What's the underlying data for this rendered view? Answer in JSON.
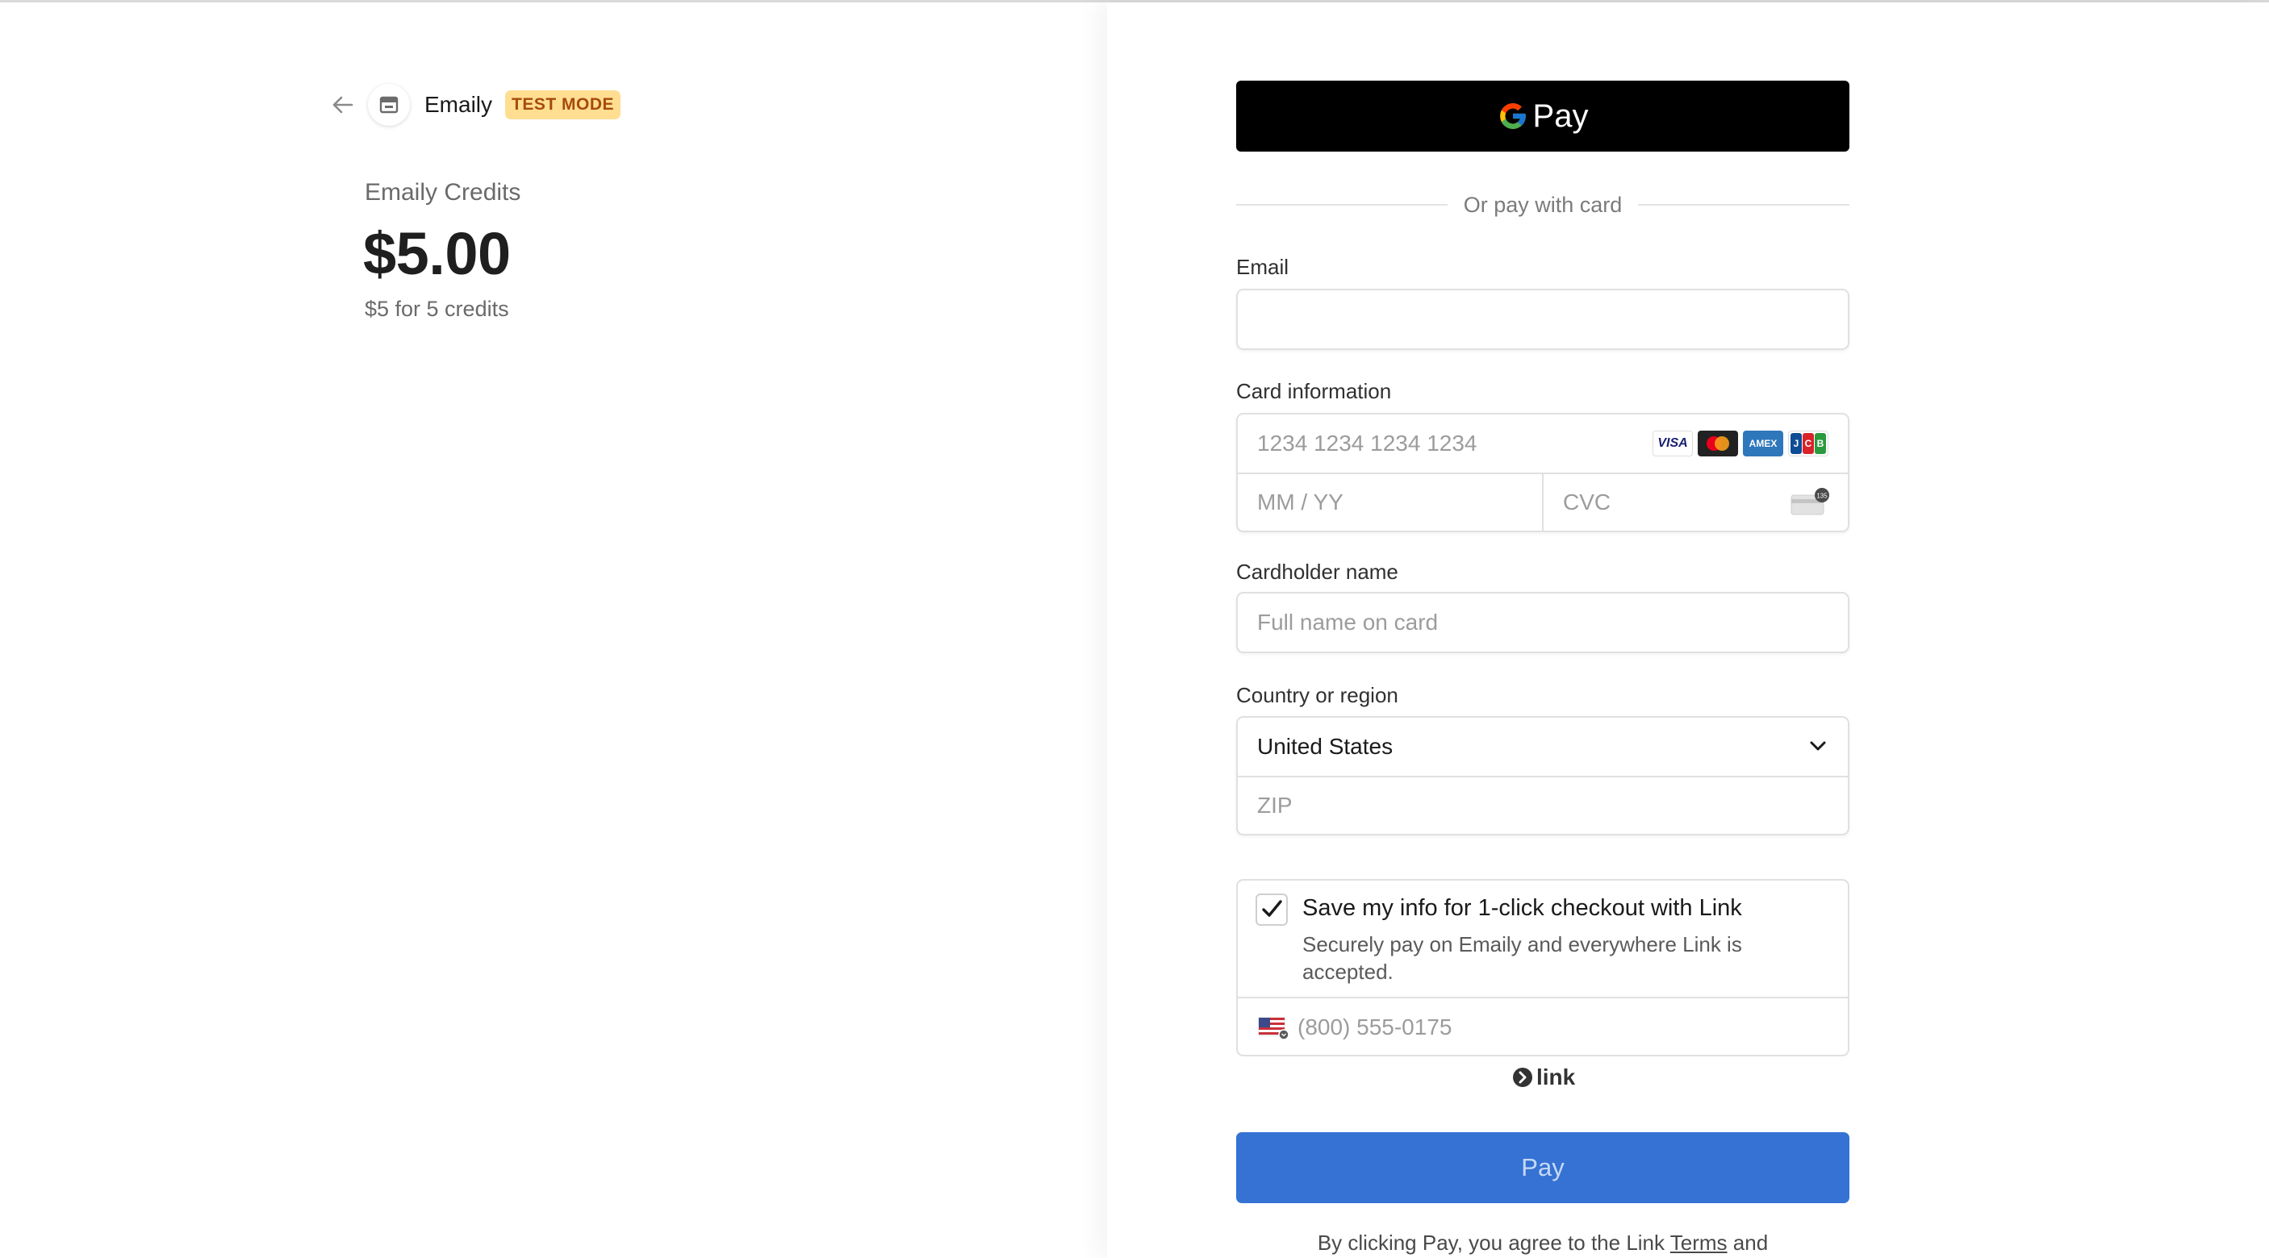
{
  "merchant": {
    "name": "Emaily",
    "badge": "TEST MODE"
  },
  "product": {
    "name": "Emaily Credits",
    "price": "$5.00",
    "description": "$5 for 5 credits"
  },
  "gpay": {
    "label": "Pay"
  },
  "divider": {
    "text": "Or pay with card"
  },
  "email": {
    "label": "Email",
    "value": ""
  },
  "card": {
    "label": "Card information",
    "number_placeholder": "1234 1234 1234 1234",
    "expiry_placeholder": "MM / YY",
    "cvc_placeholder": "CVC",
    "brands": [
      "VISA",
      "mastercard",
      "AMEX",
      "JCB"
    ],
    "cvc_badge": "135"
  },
  "cardholder": {
    "label": "Cardholder name",
    "placeholder": "Full name on card"
  },
  "country": {
    "label": "Country or region",
    "selected": "United States",
    "zip_placeholder": "ZIP"
  },
  "link_save": {
    "checked": true,
    "title": "Save my info for 1-click checkout with Link",
    "description": "Securely pay on Emaily and everywhere Link is accepted.",
    "phone_placeholder": "(800) 555-0175",
    "logo_text": "link"
  },
  "pay_button": {
    "label": "Pay"
  },
  "legal": {
    "prefix": "By clicking Pay, you agree to the Link ",
    "terms": "Terms",
    "suffix": " and"
  },
  "colors": {
    "accent": "#3572d3",
    "badge_bg": "#ffde92",
    "badge_text": "#a74b0b"
  },
  "icons": [
    "back-arrow-icon",
    "store-icon",
    "google-g-icon",
    "chevron-down-icon",
    "checkmark-icon",
    "cvc-card-icon",
    "us-flag-icon",
    "link-arrow-icon"
  ]
}
